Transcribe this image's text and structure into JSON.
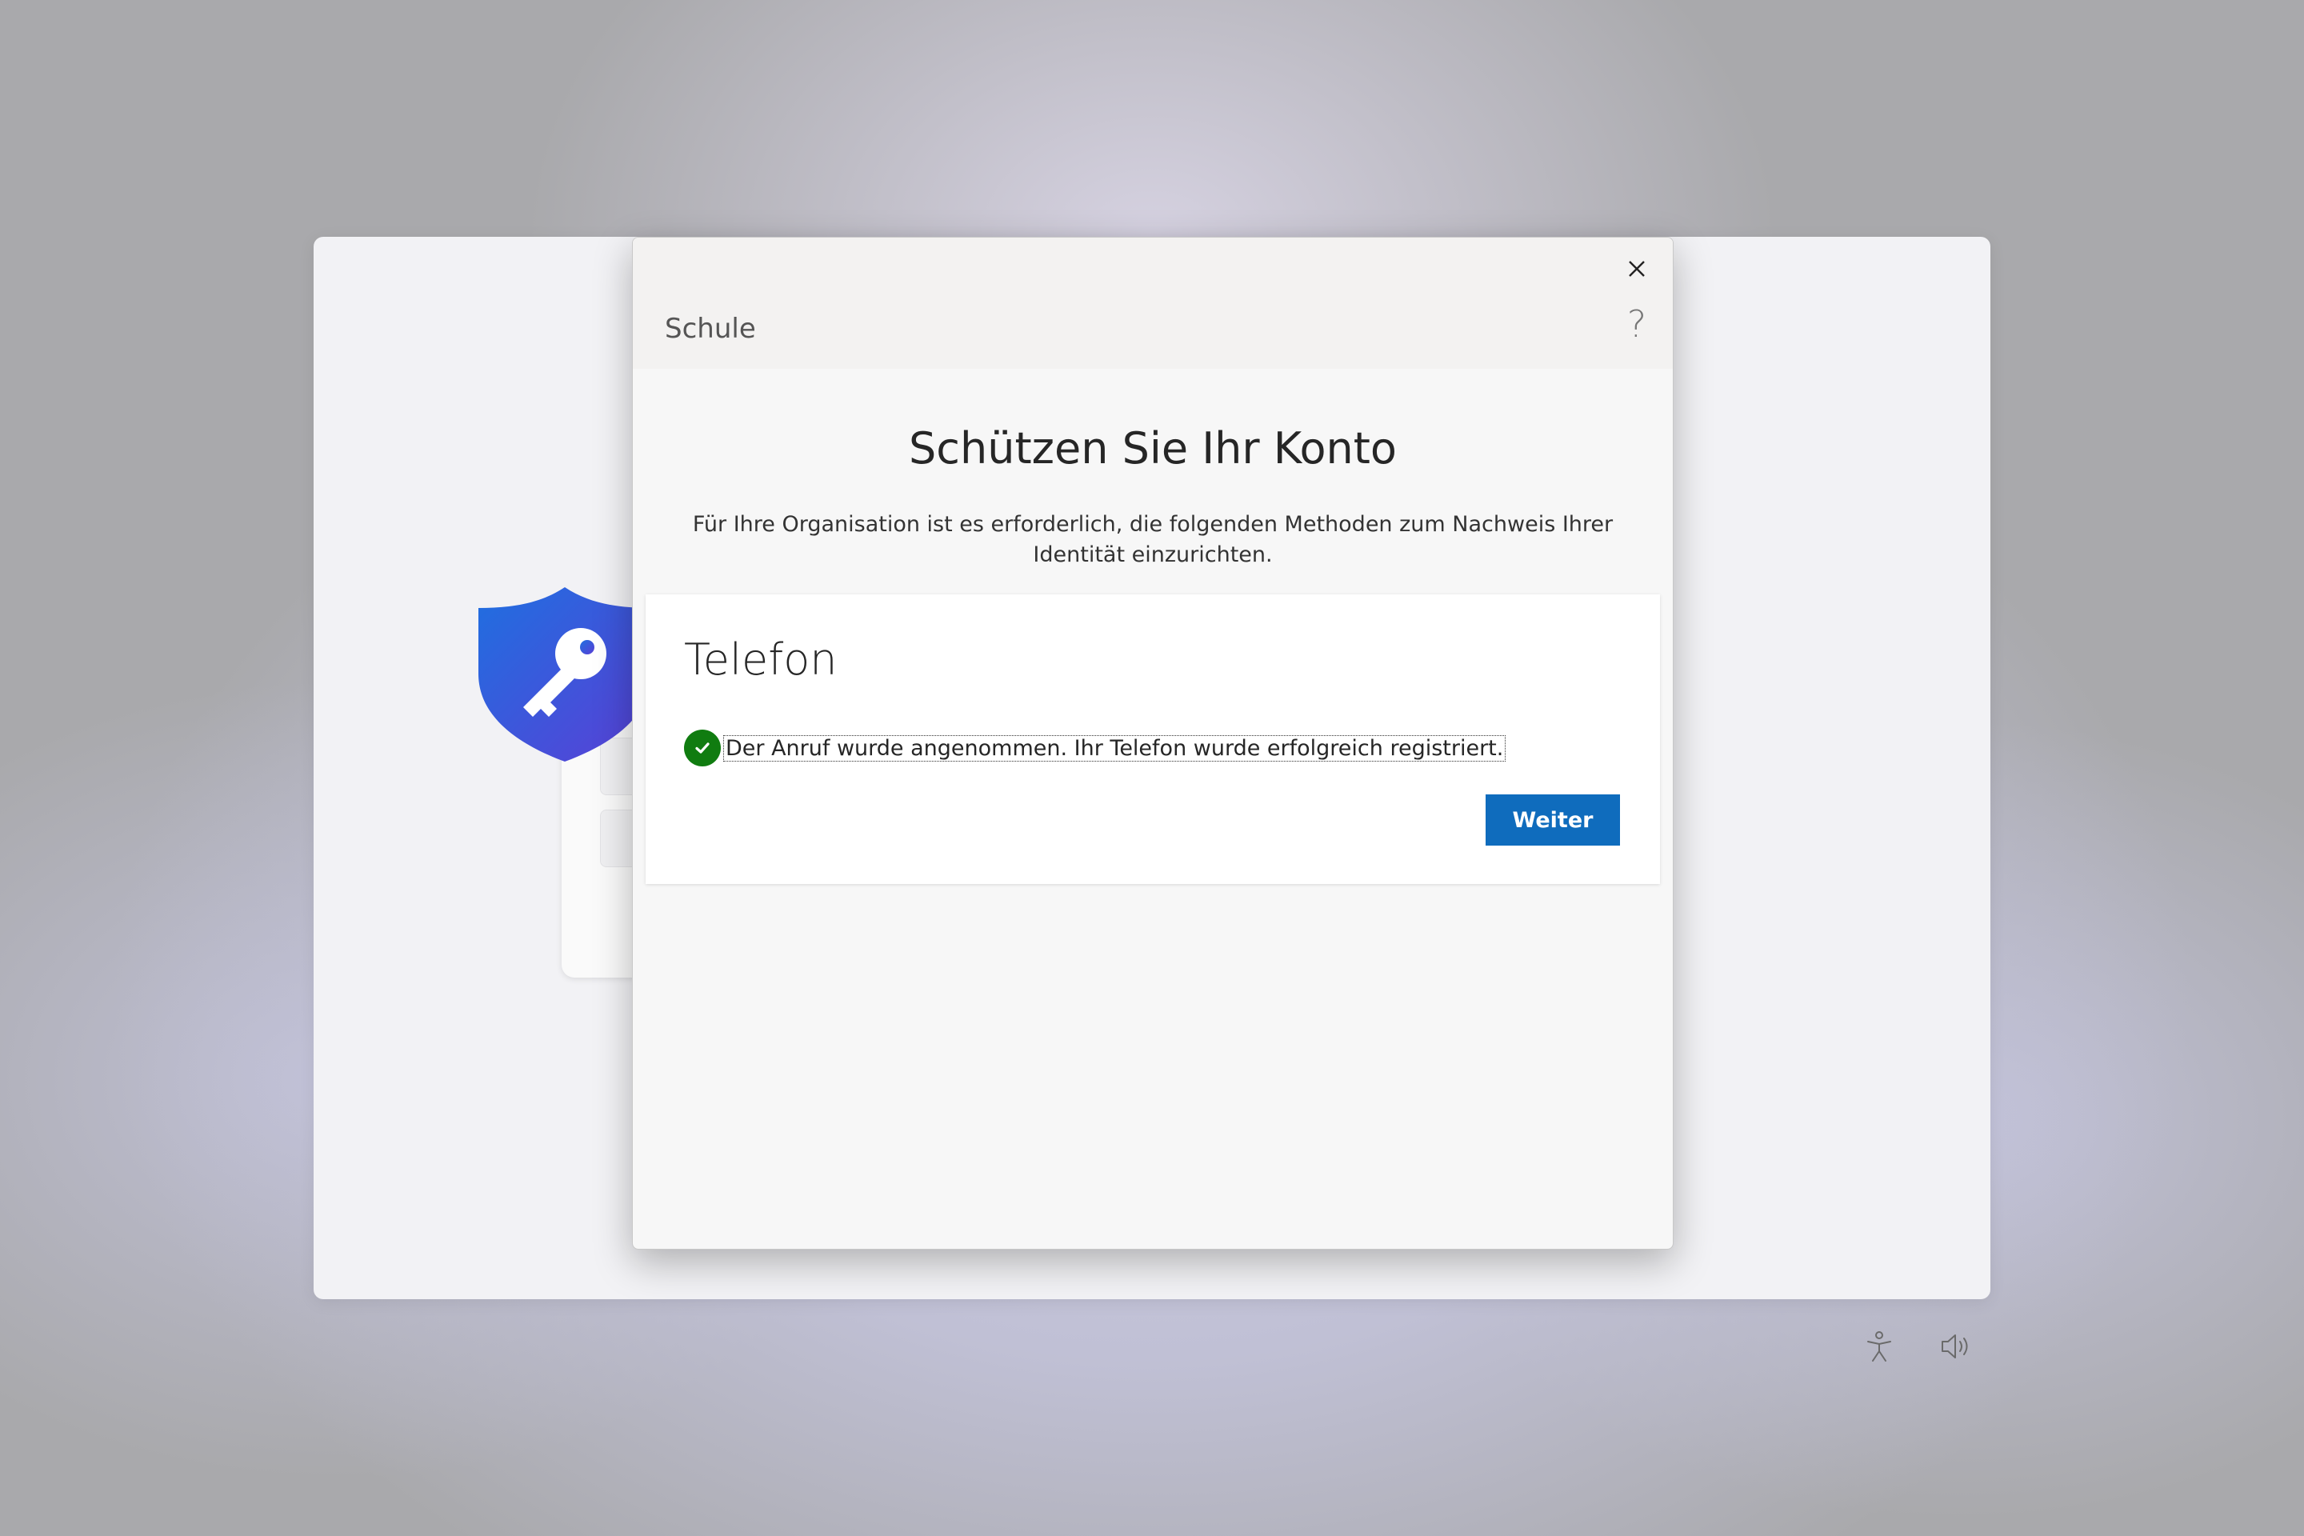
{
  "dialog": {
    "org_name": "Schule",
    "help_label": "?",
    "title": "Schützen Sie Ihr Konto",
    "subtitle": "Für Ihre Organisation ist es erforderlich, die folgenden Methoden zum Nachweis Ihrer Identität einzurichten.",
    "method_card": {
      "title": "Telefon",
      "status_text": "Der Anruf wurde angenommen. Ihr Telefon wurde erfolgreich registriert.",
      "next_button_label": "Weiter"
    }
  },
  "icons": {
    "close": "close-icon",
    "help": "help-icon",
    "status": "checkmark-icon",
    "hero": "shield-key-icon",
    "accessibility": "accessibility-icon",
    "volume": "volume-icon"
  },
  "colors": {
    "primary_button": "#0f6cbd",
    "success": "#107c10",
    "shield_top": "#1f6fe0",
    "shield_bottom": "#5a3fd6"
  }
}
